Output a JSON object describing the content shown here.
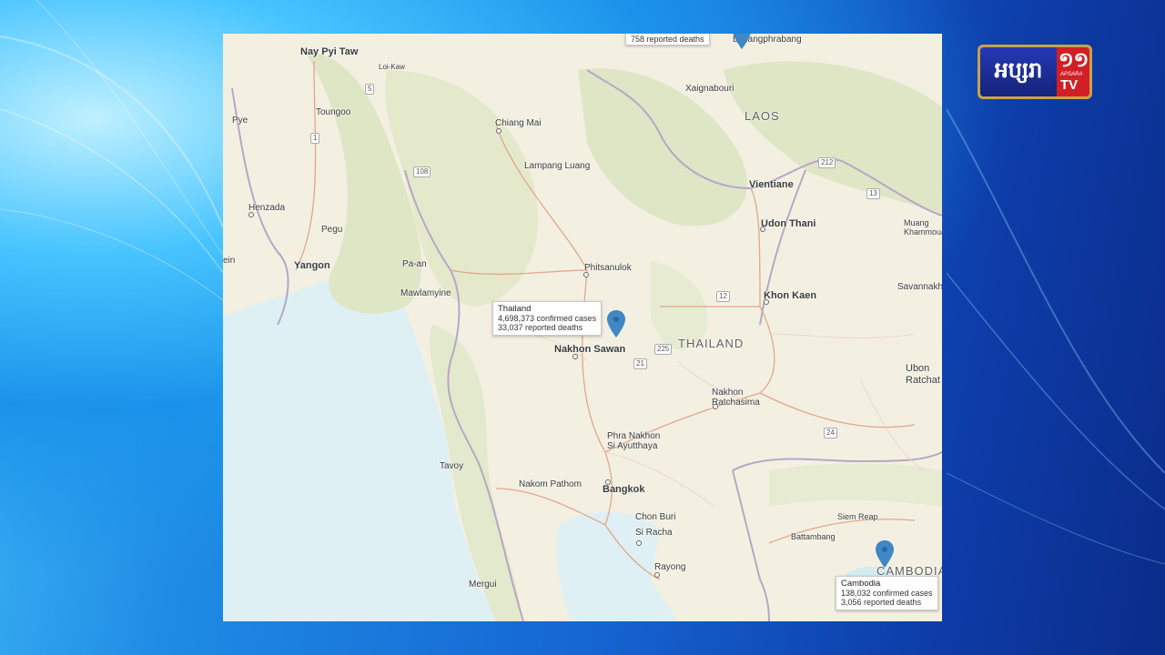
{
  "logo": {
    "khmer_text": "អប្សរា",
    "number_text": "១១",
    "small_text": "APSARA",
    "tv_text": "TV"
  },
  "map": {
    "countries": {
      "thailand": "THAILAND",
      "laos": "LAOS",
      "cambodia": "CAMBODIA"
    },
    "cities": {
      "nay_pyi_taw": "Nay Pyi Taw",
      "loi_kaw": "Loi-Kaw",
      "taungoo": "Toungoo",
      "pye": "Pye",
      "henzada": "Henzada",
      "pegu": "Pegu",
      "yangon": "Yangon",
      "ein": "ein",
      "pa_an": "Pa-an",
      "mawlamyine": "Mawlamyine",
      "tavoy": "Tavoy",
      "mergui": "Mergui",
      "chiang_mai": "Chiang Mai",
      "lampang": "Lampang Luang",
      "xaignabouri": "Xaignabouri",
      "louangphrabang": "Louangphrabang",
      "vientiane": "Vientiane",
      "udon_thani": "Udon Thani",
      "muang_khammouan": "Muang\nKhammouan",
      "savannakhet": "Savannakhe",
      "phitsanulok": "Phitsanulok",
      "khon_kaen": "Khon Kaen",
      "nakhon_sawan": "Nakhon Sawan",
      "nakhon_ratchasima": "Nakhon\nRatchasima",
      "ubon": "Ubon\nRatchat",
      "ayutthaya": "Phra Nakhon\nSi Ayutthaya",
      "nakhon_pathom": "Nakom Pathom",
      "bangkok": "Bangkok",
      "chon_buri": "Chon Buri",
      "si_racha": "Si Racha",
      "rayong": "Rayong",
      "battambang": "Battambang",
      "siem_reap": "Siem Reap"
    },
    "road_shields": [
      "5",
      "1",
      "108",
      "12",
      "225",
      "21",
      "212",
      "13",
      "24"
    ],
    "popups": {
      "laos_top": {
        "deaths": "758 reported deaths"
      },
      "thailand": {
        "title": "Thailand",
        "cases": "4,698,373 confirmed cases",
        "deaths": "33,037 reported deaths"
      },
      "cambodia": {
        "title": "Cambodia",
        "cases": "138,032 confirmed cases",
        "deaths": "3,056 reported deaths"
      }
    },
    "colors": {
      "land": "#f3f0e2",
      "forest": "#dfe6c6",
      "water": "#dff0f4",
      "pin": "#3f87c5",
      "border": "#b7a7c6",
      "road": "#e3a68c"
    }
  }
}
